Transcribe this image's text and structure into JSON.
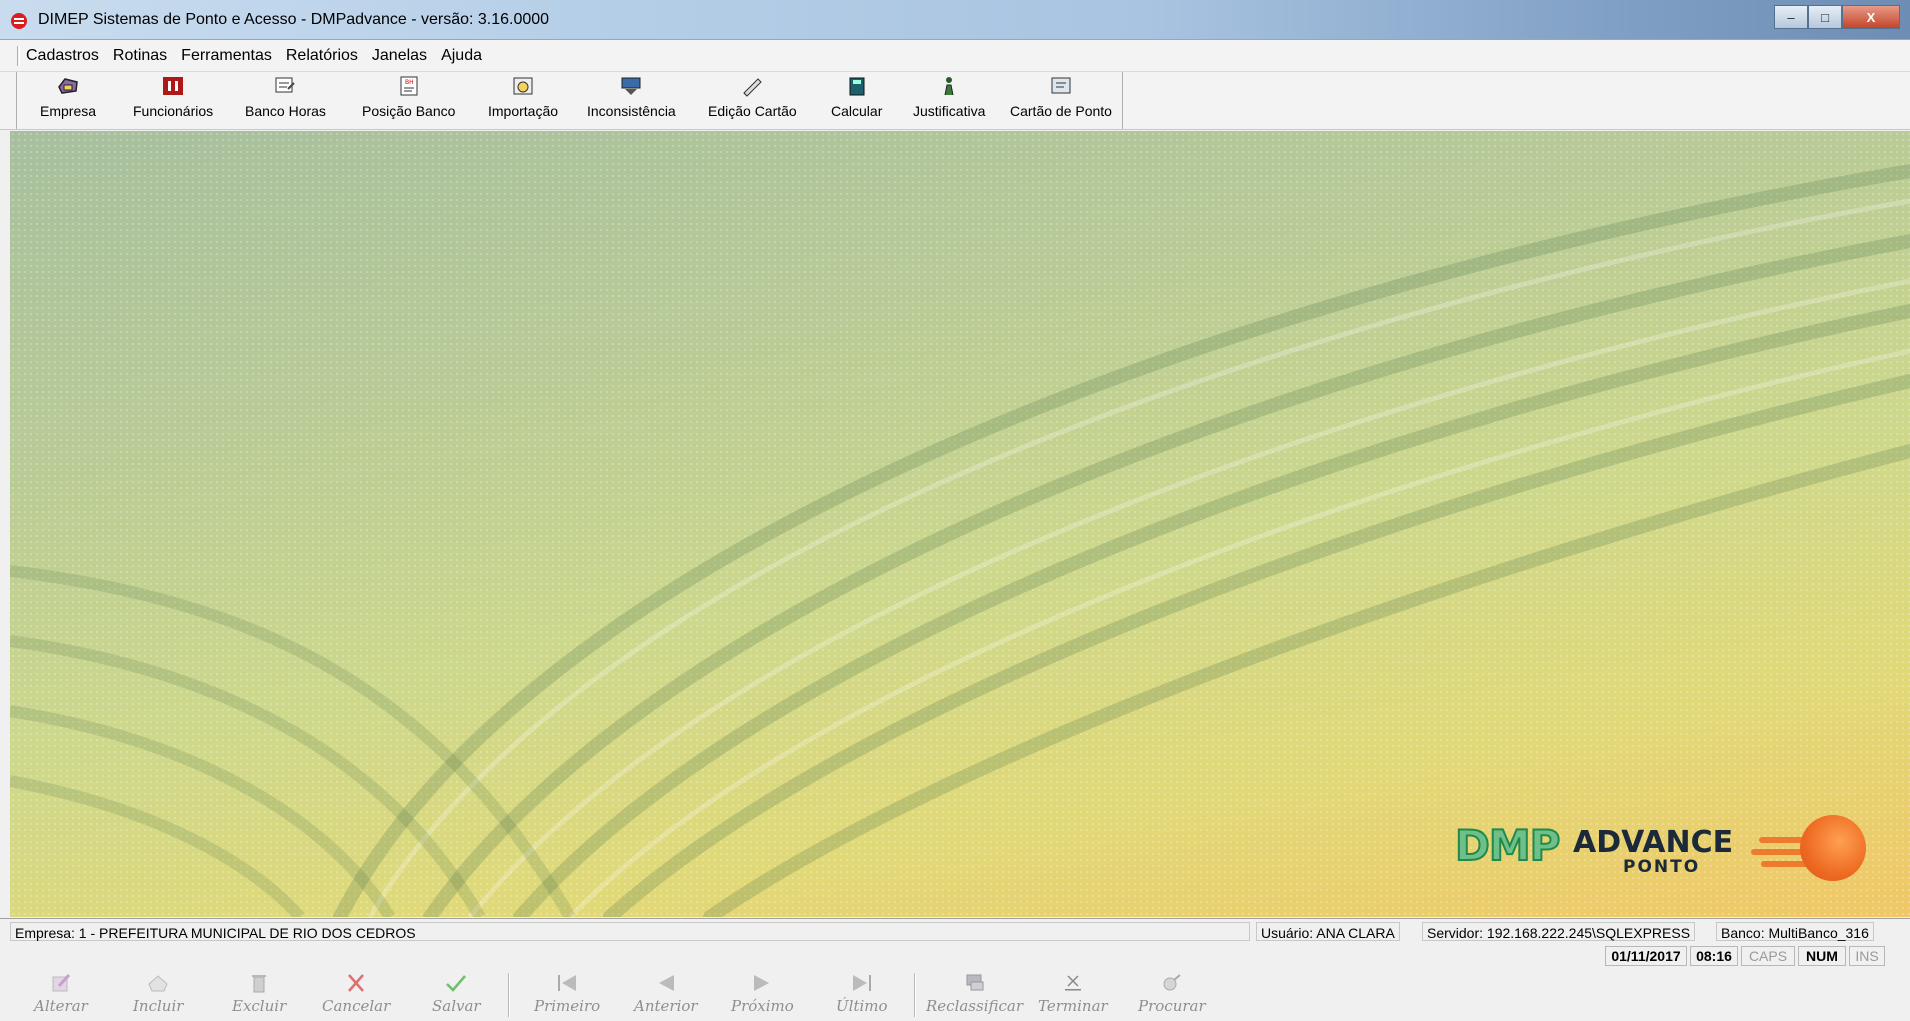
{
  "window": {
    "title": "DIMEP Sistemas de Ponto e Acesso - DMPadvance - versão: 3.16.0000",
    "minimize": "–",
    "maximize": "□",
    "close": "X"
  },
  "menu": [
    "Cadastros",
    "Rotinas",
    "Ferramentas",
    "Relatórios",
    "Janelas",
    "Ajuda"
  ],
  "toolbar": [
    {
      "label": "Empresa",
      "icon": "building-icon"
    },
    {
      "label": "Funcionários",
      "icon": "employees-icon"
    },
    {
      "label": "Banco Horas",
      "icon": "hours-bank-icon"
    },
    {
      "label": "Posição Banco",
      "icon": "bank-position-icon"
    },
    {
      "label": "Importação",
      "icon": "import-icon"
    },
    {
      "label": "Inconsistência",
      "icon": "inconsistency-icon"
    },
    {
      "label": "Edição Cartão",
      "icon": "card-edit-icon"
    },
    {
      "label": "Calcular",
      "icon": "calculator-icon"
    },
    {
      "label": "Justificativa",
      "icon": "justification-icon"
    },
    {
      "label": "Cartão de Ponto",
      "icon": "timecard-icon"
    }
  ],
  "logo": {
    "dmp": "DMP",
    "advance": "ADVANCE",
    "ponto": "PONTO",
    "colors": {
      "green": "#1f8a4a",
      "orange": "#ee6a22",
      "navy": "#1b2a3a"
    }
  },
  "status": {
    "empresa": "Empresa: 1 - PREFEITURA MUNICIPAL DE RIO DOS CEDROS",
    "usuario": "Usuário: ANA CLARA",
    "servidor": "Servidor: 192.168.222.245\\SQLEXPRESS",
    "banco": "Banco: MultiBanco_316",
    "date": "01/11/2017",
    "time": "08:16",
    "caps": "CAPS",
    "num": "NUM",
    "ins": "INS"
  },
  "navigation": [
    {
      "label": "Alterar",
      "icon": "edit-icon"
    },
    {
      "label": "Incluir",
      "icon": "add-icon"
    },
    {
      "label": "Excluir",
      "icon": "trash-icon"
    },
    {
      "label": "Cancelar",
      "icon": "cancel-icon"
    },
    {
      "label": "Salvar",
      "icon": "check-icon"
    },
    {
      "label": "Primeiro",
      "icon": "first-icon"
    },
    {
      "label": "Anterior",
      "icon": "previous-icon"
    },
    {
      "label": "Próximo",
      "icon": "next-icon"
    },
    {
      "label": "Último",
      "icon": "last-icon"
    },
    {
      "label": "Reclassificar",
      "icon": "reclassify-icon"
    },
    {
      "label": "Terminar",
      "icon": "finish-icon"
    },
    {
      "label": "Procurar",
      "icon": "search-icon"
    }
  ]
}
